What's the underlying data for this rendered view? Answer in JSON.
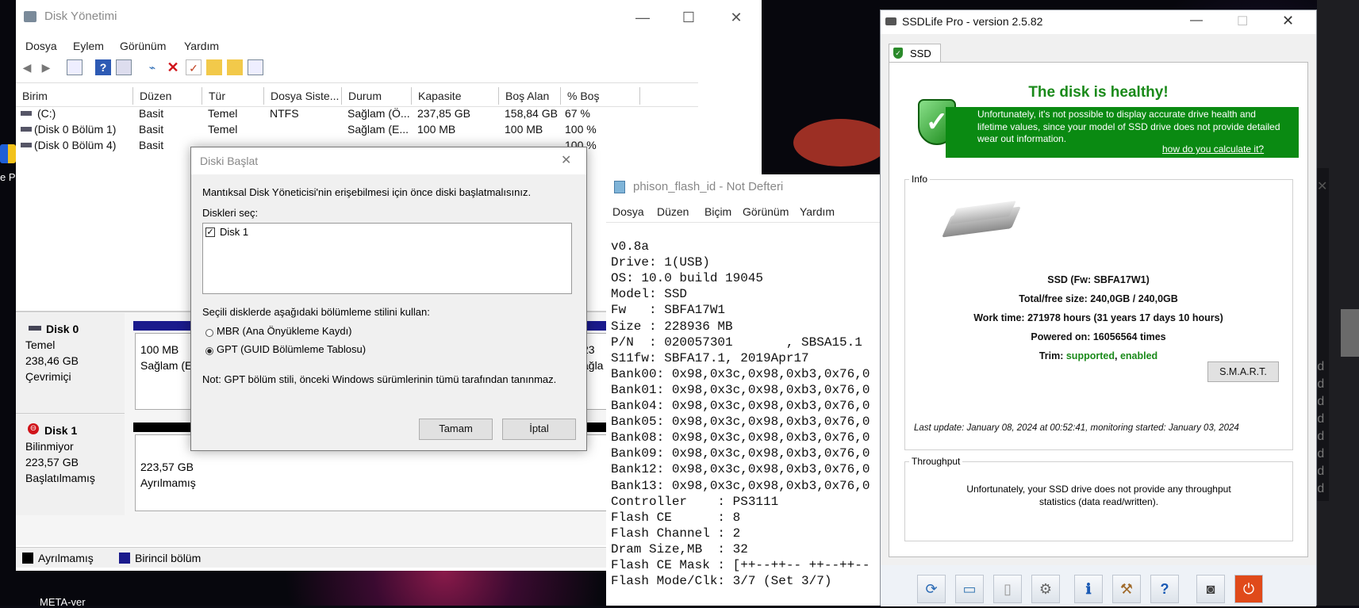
{
  "disk_manager": {
    "title": "Disk Yönetimi",
    "menu": [
      "Dosya",
      "Eylem",
      "Görünüm",
      "Yardım"
    ],
    "columns": [
      "Birim",
      "Düzen",
      "Tür",
      "Dosya Siste...",
      "Durum",
      "Kapasite",
      "Boş Alan",
      "% Boş"
    ],
    "volumes": [
      {
        "name": "(C:)",
        "layout": "Basit",
        "type": "Temel",
        "fs": "NTFS",
        "status": "Sağlam (Ö...",
        "capacity": "237,85 GB",
        "free": "158,84 GB",
        "pct": "67 %"
      },
      {
        "name": "(Disk 0 Bölüm 1)",
        "layout": "Basit",
        "type": "Temel",
        "fs": "",
        "status": "Sağlam (E...",
        "capacity": "100 MB",
        "free": "100 MB",
        "pct": "100 %"
      },
      {
        "name": "(Disk 0 Bölüm 4)",
        "layout": "Basit",
        "type": "Temel",
        "fs": "",
        "status": "",
        "capacity": "",
        "free": "",
        "pct": "100 %"
      }
    ],
    "disks": [
      {
        "name": "Disk 0",
        "kind": "Temel",
        "size": "238,46 GB",
        "state": "Çevrimiçi",
        "part_size": "100 MB",
        "part_status": "Sağlam (EF",
        "part_right": "23",
        "part_right2": "ağla"
      },
      {
        "name": "Disk 1",
        "kind": "Bilinmiyor",
        "size": "223,57 GB",
        "state": "Başlatılmamış",
        "part_size": "223,57 GB",
        "part_status": "Ayrılmamış"
      }
    ],
    "legend": [
      "Ayrılmamış",
      "Birincil bölüm"
    ]
  },
  "dialog": {
    "title": "Diski Başlat",
    "intro": "Mantıksal Disk Yöneticisi'nin erişebilmesi için önce diski başlatmalısınız.",
    "select_label": "Diskleri seç:",
    "disk_item": "Disk 1",
    "style_label": "Seçili disklerde aşağıdaki bölümleme stilini kullan:",
    "mbr": "MBR (Ana Önyükleme Kaydı)",
    "gpt": "GPT (GUID Bölümleme Tablosu)",
    "note": "Not: GPT bölüm stili, önceki Windows sürümlerinin tümü tarafından tanınmaz.",
    "ok": "Tamam",
    "cancel": "İptal"
  },
  "notepad": {
    "title": "phison_flash_id - Not Defteri",
    "menu": [
      "Dosya",
      "Düzen",
      "Biçim",
      "Görünüm",
      "Yardım"
    ],
    "lines": [
      "v0.8a",
      "Drive: 1(USB)",
      "OS: 10.0 build 19045",
      "Model: SSD",
      "Fw   : SBFA17W1",
      "Size : 228936 MB",
      "P/N  : 020057301       , SBSA15.1",
      "S11fw: SBFA17.1, 2019Apr17",
      "Bank00: 0x98,0x3c,0x98,0xb3,0x76,0",
      "Bank01: 0x98,0x3c,0x98,0xb3,0x76,0",
      "Bank04: 0x98,0x3c,0x98,0xb3,0x76,0",
      "Bank05: 0x98,0x3c,0x98,0xb3,0x76,0",
      "Bank08: 0x98,0x3c,0x98,0xb3,0x76,0",
      "Bank09: 0x98,0x3c,0x98,0xb3,0x76,0",
      "Bank12: 0x98,0x3c,0x98,0xb3,0x76,0",
      "Bank13: 0x98,0x3c,0x98,0xb3,0x76,0",
      "Controller    : PS3111",
      "Flash CE      : 8",
      "Flash Channel : 2",
      "Dram Size,MB  : 32",
      "Flash CE Mask : [++--++-- ++--++--",
      "Flash Mode/Clk: 3/7 (Set 3/7)"
    ]
  },
  "ssdlife": {
    "title": "SSDLife Pro - version 2.5.82",
    "tab": "SSD",
    "status_title": "The disk is healthy!",
    "status_msg": "Unfortunately, it's not possible to display accurate drive health and lifetime values, since your model of SSD drive does not provide detailed wear out information.",
    "calc_link": "how do you calculate it?",
    "info_group": "Info",
    "drive": "SSD (Fw: SBFA17W1)",
    "total_free": "Total/free size: 240,0GB / 240,0GB",
    "work_time": "Work time: 271978 hours (31 years 17 days 10 hours)",
    "powered_on": "Powered on: 16056564 times",
    "trim_label": "Trim:",
    "trim_supported": "supported",
    "trim_sep": ",",
    "trim_enabled": "enabled",
    "smart": "S.M.A.R.T.",
    "last_update": "Last update: January 08, 2024 at 00:52:41, monitoring started: January 03, 2024",
    "throughput_group": "Throughput",
    "throughput_msg": "Unfortunately, your SSD drive does not provide any throughput statistics (data read/written).",
    "accent_green": "#0a8a12",
    "healthy_text": "#1a8a1a"
  },
  "desktop": {
    "left_label": "e Pr",
    "bottom_label": "META-ver",
    "right_glyph": "d"
  }
}
